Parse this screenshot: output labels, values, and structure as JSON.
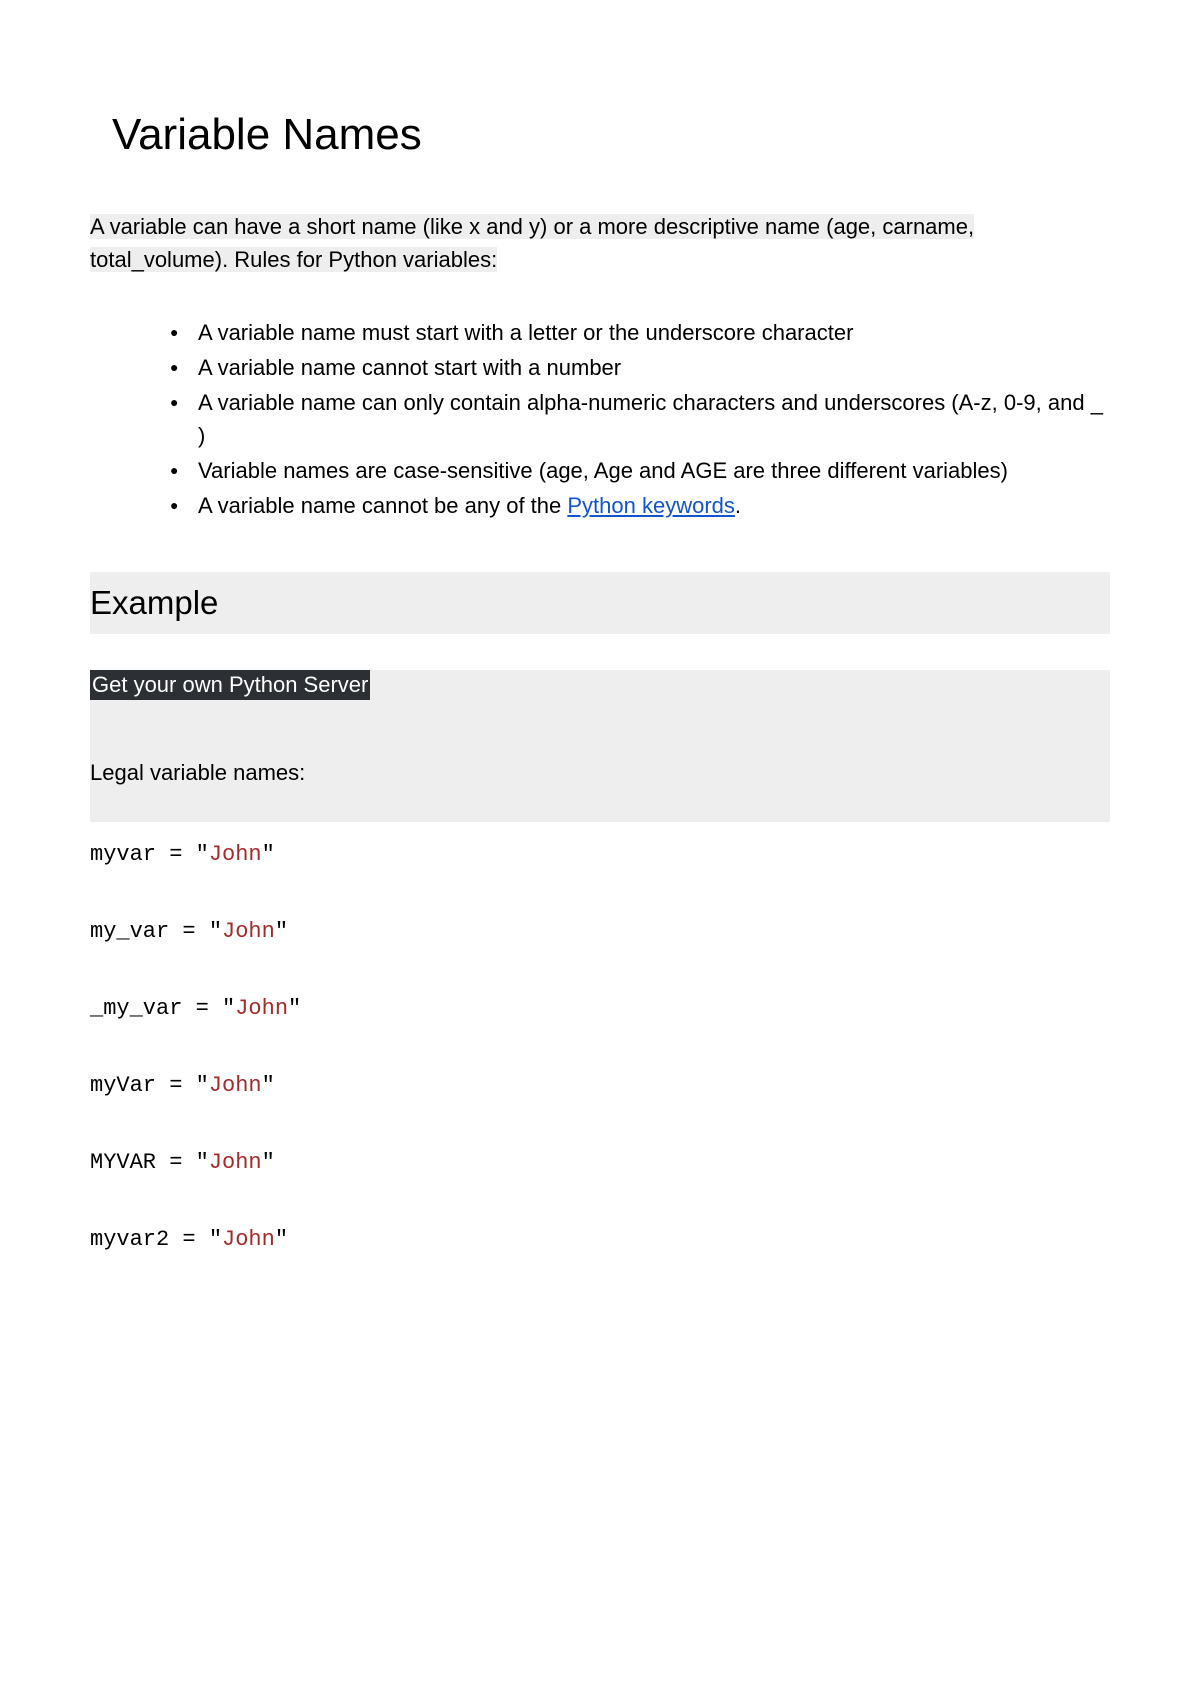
{
  "title": "Variable Names",
  "intro": "A variable can have a short name (like x and y) or a more descriptive name (age, carname, total_volume). Rules for Python variables:",
  "bullets": [
    "A variable name must start with a letter or the underscore character",
    "A variable name cannot start with a number",
    "A variable name can only contain alpha-numeric characters and underscores (A-z, 0-9, and _ )",
    "Variable names are case-sensitive (age, Age and AGE are three different variables)"
  ],
  "bullet_last_prefix": "A variable name cannot be any of the ",
  "bullet_last_link": "Python keywords",
  "bullet_last_suffix": ".",
  "example_heading": "Example",
  "banner": "Get your own Python Server",
  "legal_label": "Legal variable names:",
  "code": [
    {
      "var": "myvar",
      "op": " = ",
      "q1": "\"",
      "str": "John",
      "q2": "\""
    },
    {
      "var": "my_var",
      "op": " = ",
      "q1": "\"",
      "str": "John",
      "q2": "\""
    },
    {
      "var": "_my_var",
      "op": " = ",
      "q1": "\"",
      "str": "John",
      "q2": "\""
    },
    {
      "var": "myVar",
      "op": " = ",
      "q1": "\"",
      "str": "John",
      "q2": "\""
    },
    {
      "var": "MYVAR",
      "op": " = ",
      "q1": "\"",
      "str": "John",
      "q2": "\""
    },
    {
      "var": "myvar2",
      "op": " = ",
      "q1": "\"",
      "str": "John",
      "q2": "\""
    }
  ]
}
